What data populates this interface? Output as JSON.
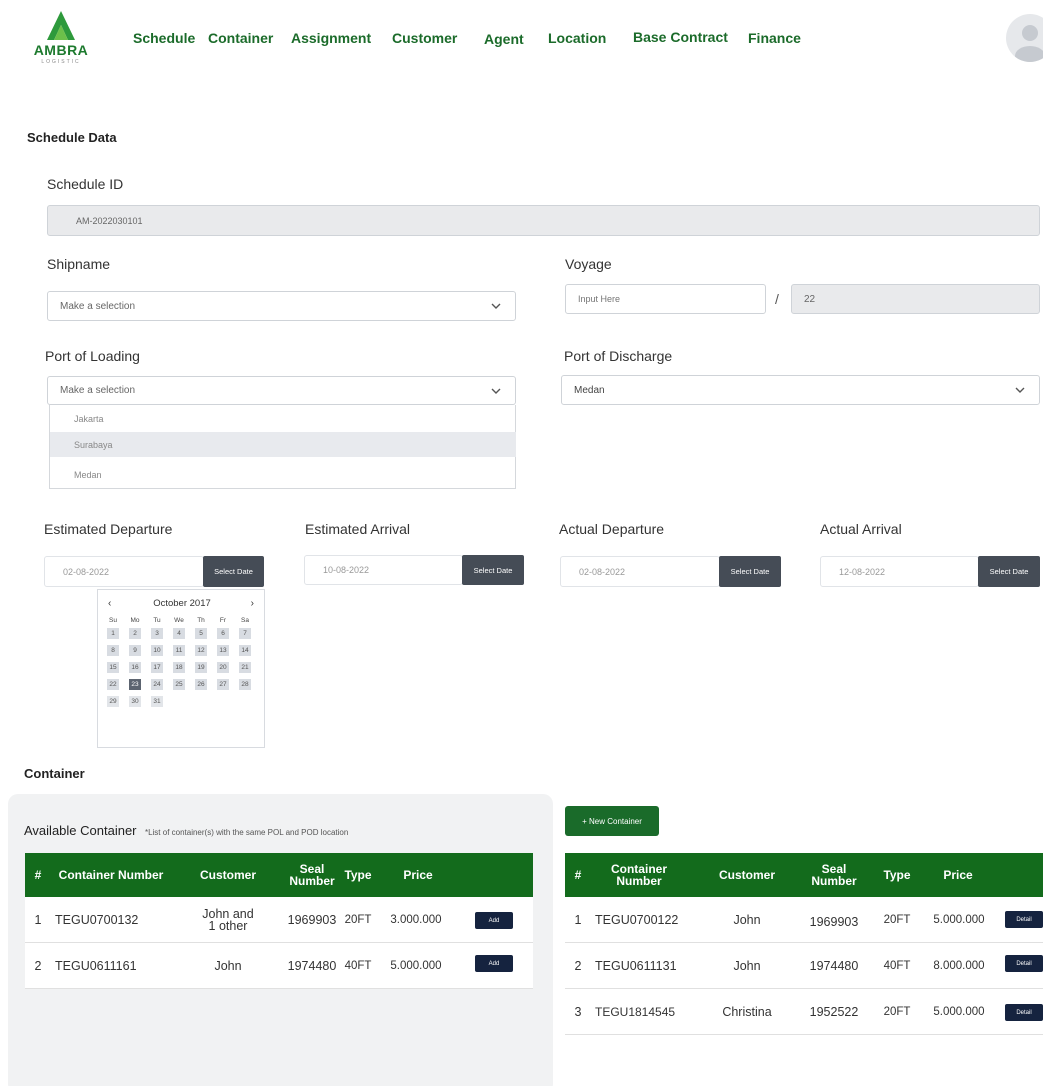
{
  "brand": {
    "name": "AMBRA",
    "sub": "LOGISTIC",
    "primary": "#1b6b2a",
    "table_header": "#136b1c",
    "button_dark": "#15233f"
  },
  "nav": [
    "Schedule",
    "Container",
    "Assignment",
    "Customer",
    "Agent",
    "Location",
    "Base Contract",
    "Finance"
  ],
  "schedule": {
    "section_title": "Schedule Data",
    "schedule_id_label": "Schedule ID",
    "schedule_id_value": "AM-2022030101",
    "shipname_label": "Shipname",
    "shipname_value": "Make a selection",
    "voyage_label": "Voyage",
    "voyage_placeholder": "Input Here",
    "voyage_separator": "/",
    "voyage_value": "22",
    "pol_label": "Port of Loading",
    "pol_value": "Make a selection",
    "pol_options": [
      "Jakarta",
      "Surabaya",
      "Medan"
    ],
    "pod_label": "Port of Discharge",
    "pod_value": "Medan"
  },
  "dates": [
    {
      "label": "Estimated Departure",
      "value": "02-08-2022",
      "button": "Select Date"
    },
    {
      "label": "Estimated Arrival",
      "value": "10-08-2022",
      "button": "Select Date"
    },
    {
      "label": "Actual Departure",
      "value": "02-08-2022",
      "button": "Select Date"
    },
    {
      "label": "Actual Arrival",
      "value": "12-08-2022",
      "button": "Select Date"
    }
  ],
  "calendar": {
    "prev": "‹",
    "next": "›",
    "month": "October 2017",
    "weekdays": [
      "Su",
      "Mo",
      "Tu",
      "We",
      "Th",
      "Fr",
      "Sa"
    ],
    "days": [
      "1",
      "2",
      "3",
      "4",
      "5",
      "6",
      "7",
      "8",
      "9",
      "10",
      "11",
      "12",
      "13",
      "14",
      "15",
      "16",
      "17",
      "18",
      "19",
      "20",
      "21",
      "22",
      "23",
      "24",
      "25",
      "26",
      "27",
      "28",
      "29",
      "30",
      "31"
    ],
    "selected": "23"
  },
  "container": {
    "section_title": "Container",
    "available_title": "Available Container",
    "available_note": "*List of container(s) with the same POL and POD location",
    "new_button": "+ New Container",
    "headers": [
      "#",
      "Container Number",
      "Customer",
      "Seal Number",
      "Type",
      "Price"
    ],
    "available": [
      {
        "no": "1",
        "number": "TEGU0700132",
        "customer": "John and 1 other",
        "seal": "1969903",
        "type": "20FT",
        "price": "3.000.000",
        "action": "Add"
      },
      {
        "no": "2",
        "number": "TEGU0611161",
        "customer": "John",
        "seal": "1974480",
        "type": "40FT",
        "price": "5.000.000",
        "action": "Add"
      }
    ],
    "assigned": [
      {
        "no": "1",
        "number": "TEGU0700122",
        "customer": "John",
        "seal": "1969903",
        "type": "20FT",
        "price": "5.000.000",
        "action": "Detail"
      },
      {
        "no": "2",
        "number": "TEGU0611131",
        "customer": "John",
        "seal": "1974480",
        "type": "40FT",
        "price": "8.000.000",
        "action": "Detail"
      },
      {
        "no": "3",
        "number": "TEGU1814545",
        "customer": "Christina",
        "seal": "1952522",
        "type": "20FT",
        "price": "5.000.000",
        "action": "Detail"
      }
    ]
  }
}
